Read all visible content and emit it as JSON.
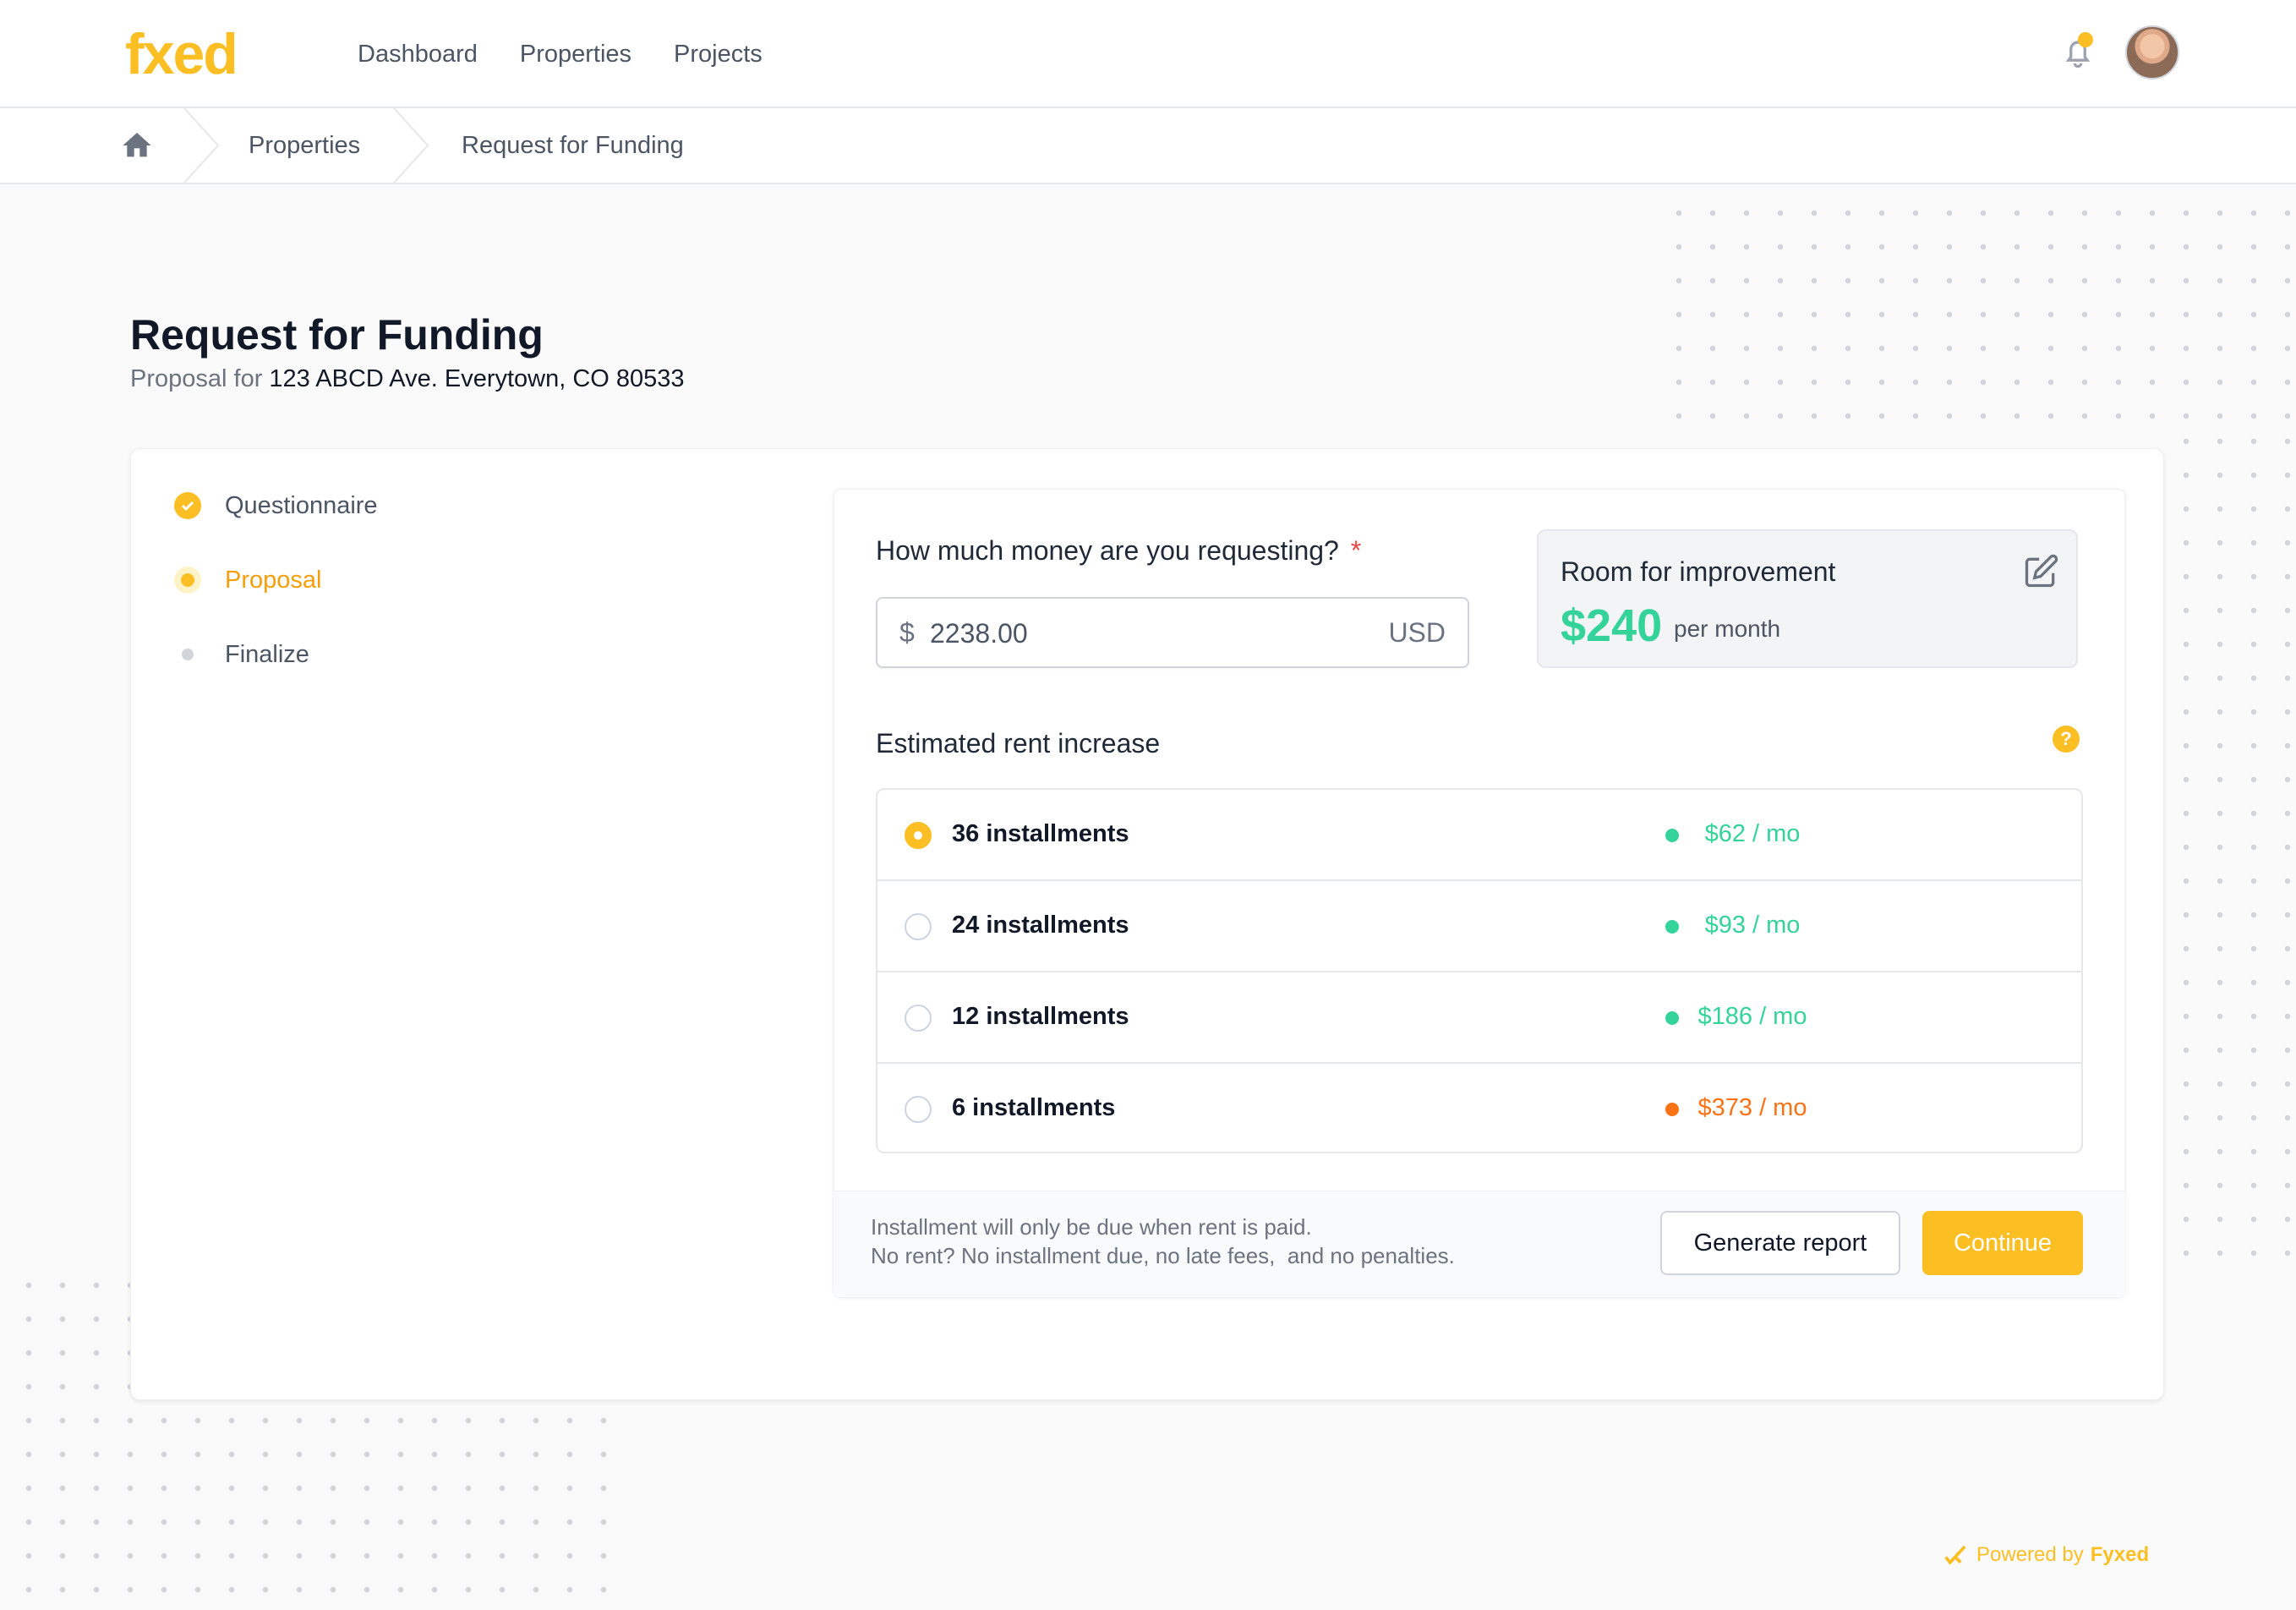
{
  "header": {
    "logo": "fxed",
    "nav": [
      "Dashboard",
      "Properties",
      "Projects"
    ]
  },
  "breadcrumb": {
    "items": [
      "Properties",
      "Request for Funding"
    ]
  },
  "page": {
    "title": "Request for Funding",
    "subtitle_prefix": "Proposal for",
    "address": "123 ABCD Ave. Everytown, CO 80533"
  },
  "steps": [
    {
      "label": "Questionnaire",
      "state": "done"
    },
    {
      "label": "Proposal",
      "state": "current"
    },
    {
      "label": "Finalize",
      "state": "pending"
    }
  ],
  "request": {
    "label": "How much money are you requesting?",
    "required_mark": "*",
    "currency_symbol": "$",
    "value": "2238.00",
    "unit": "USD"
  },
  "room": {
    "title": "Room for improvement",
    "value": "$240",
    "period": "per month"
  },
  "estimate": {
    "label": "Estimated rent increase",
    "help": "?",
    "options": [
      {
        "label": "36 installments",
        "price": "$62 / mo",
        "status_color": "#34d399",
        "selected": true
      },
      {
        "label": "24 installments",
        "price": "$93 / mo",
        "status_color": "#34d399",
        "selected": false
      },
      {
        "label": "12 installments",
        "price": "$186 / mo",
        "status_color": "#34d399",
        "selected": false
      },
      {
        "label": "6 installments",
        "price": "$373 / mo",
        "status_color": "#f97316",
        "selected": false
      }
    ]
  },
  "footer": {
    "note_line1": "Installment will only be due when rent is paid.",
    "note_line2": "No rent? No installment due, no late fees,  and no penalties.",
    "generate_label": "Generate report",
    "continue_label": "Continue"
  },
  "powered": {
    "prefix": "Powered by",
    "brand": "Fyxed"
  },
  "colors": {
    "accent": "#fbbf24",
    "success": "#34d399",
    "warning": "#f97316"
  }
}
